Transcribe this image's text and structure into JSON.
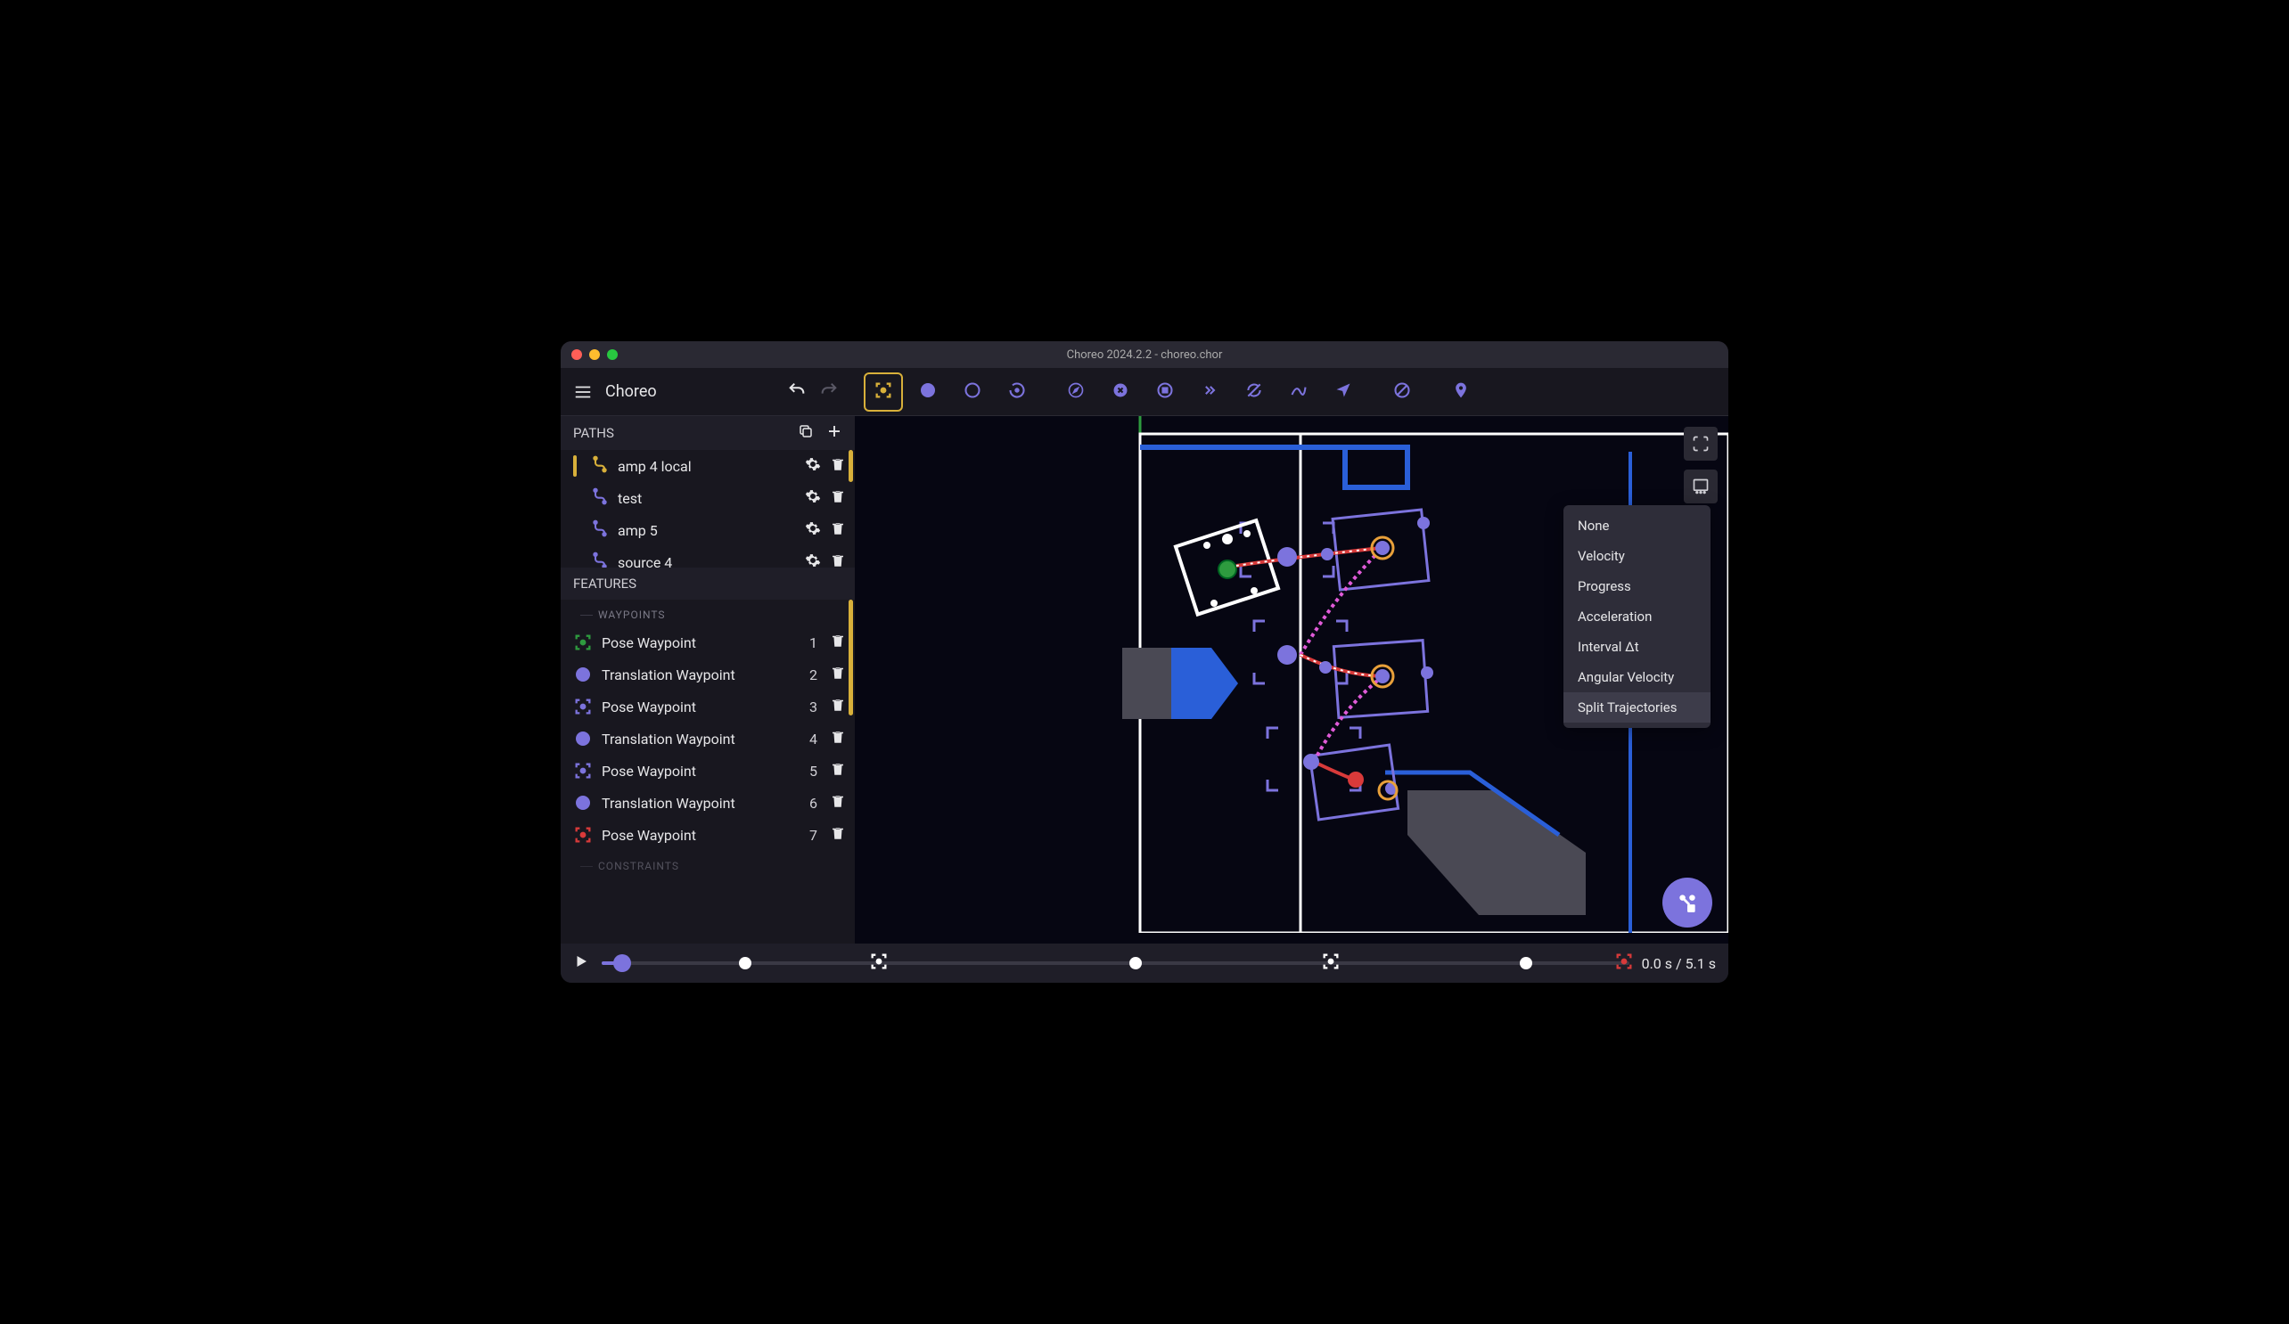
{
  "window": {
    "title": "Choreo 2024.2.2 - choreo.chor"
  },
  "header": {
    "app_name": "Choreo"
  },
  "toolbar": {
    "tools": [
      {
        "name": "pose-waypoint-tool",
        "active": true,
        "icon": "pose-box",
        "color": "#d8b03a"
      },
      {
        "name": "translation-waypoint-tool",
        "icon": "circle-fill"
      },
      {
        "name": "empty-waypoint-tool",
        "icon": "circle"
      },
      {
        "name": "rotate-tool",
        "icon": "rotate"
      },
      {
        "name": "heading-tool",
        "icon": "compass",
        "gap": true
      },
      {
        "name": "stop-tool",
        "icon": "x-circle"
      },
      {
        "name": "target-tool",
        "icon": "target"
      },
      {
        "name": "skip-tool",
        "icon": "chevrons"
      },
      {
        "name": "no-sync-tool",
        "icon": "nosync"
      },
      {
        "name": "spline-tool",
        "icon": "spline"
      },
      {
        "name": "nav-tool",
        "icon": "navigate"
      },
      {
        "name": "forbid-tool",
        "icon": "forbid",
        "gap": true
      },
      {
        "name": "pin-tool",
        "icon": "pin",
        "gap": true
      }
    ]
  },
  "sidebar": {
    "paths_header": "PATHS",
    "features_header": "FEATURES",
    "waypoints_subheader": "WAYPOINTS",
    "constraints_subheader": "CONSTRAINTS",
    "paths": [
      {
        "name": "amp 4 local",
        "active": true
      },
      {
        "name": "test",
        "active": false
      },
      {
        "name": "amp 5",
        "active": false
      },
      {
        "name": "source 4",
        "active": false
      }
    ],
    "waypoints": [
      {
        "label": "Pose Waypoint",
        "idx": "1",
        "icon": "pose-box",
        "color": "#2e9b3f"
      },
      {
        "label": "Translation Waypoint",
        "idx": "2",
        "icon": "circle-fill",
        "color": "#7c73dd"
      },
      {
        "label": "Pose Waypoint",
        "idx": "3",
        "icon": "pose-box",
        "color": "#7c73dd"
      },
      {
        "label": "Translation Waypoint",
        "idx": "4",
        "icon": "circle-fill",
        "color": "#7c73dd"
      },
      {
        "label": "Pose Waypoint",
        "idx": "5",
        "icon": "pose-box",
        "color": "#7c73dd"
      },
      {
        "label": "Translation Waypoint",
        "idx": "6",
        "icon": "circle-fill",
        "color": "#7c73dd"
      },
      {
        "label": "Pose Waypoint",
        "idx": "7",
        "icon": "pose-box",
        "color": "#d83a3a"
      }
    ]
  },
  "context_menu": {
    "items": [
      {
        "label": "None"
      },
      {
        "label": "Velocity"
      },
      {
        "label": "Progress"
      },
      {
        "label": "Acceleration"
      },
      {
        "label": "Interval Δt"
      },
      {
        "label": "Angular Velocity"
      },
      {
        "label": "Split Trajectories",
        "hover": true
      }
    ]
  },
  "timeline": {
    "current": "0.0 s",
    "total": "5.1 s",
    "thumb_pct": 2,
    "markers": [
      {
        "type": "dot",
        "pct": 14
      },
      {
        "type": "pose",
        "pct": 27,
        "color": "#fff"
      },
      {
        "type": "dot",
        "pct": 52
      },
      {
        "type": "pose",
        "pct": 71,
        "color": "#fff"
      },
      {
        "type": "dot",
        "pct": 90
      },
      {
        "type": "pose",
        "pct": 99.5,
        "color": "#d83a3a"
      }
    ]
  },
  "colors": {
    "accent": "#7c73dd",
    "gold": "#d8b03a",
    "green": "#2e9b3f",
    "red": "#d83a3a"
  }
}
